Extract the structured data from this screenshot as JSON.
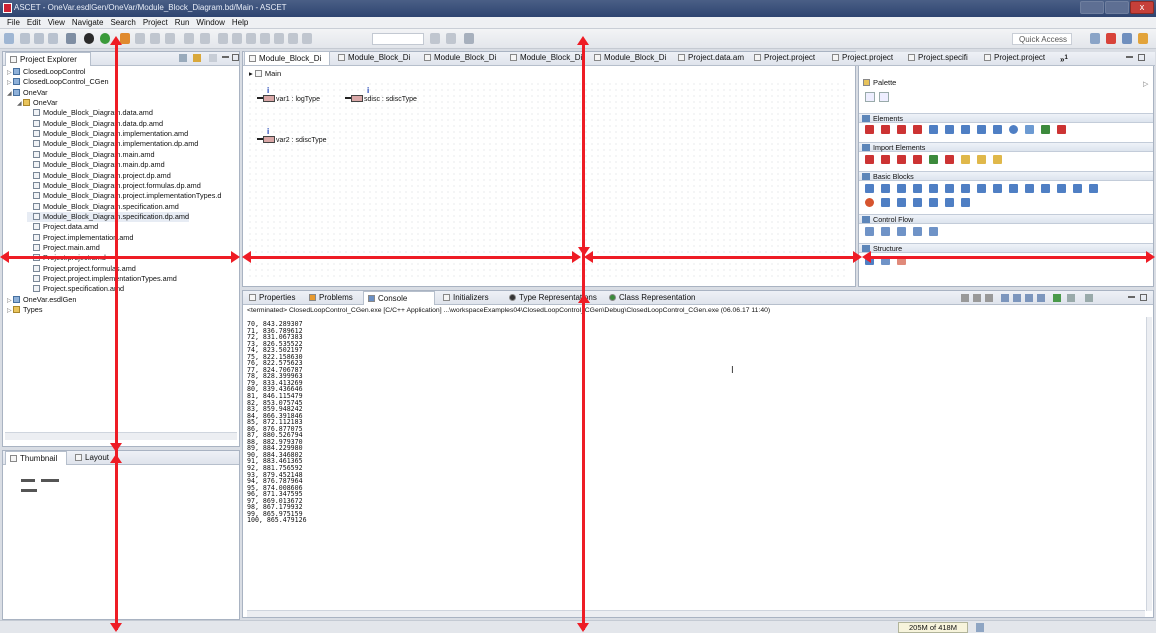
{
  "window": {
    "title": "ASCET - OneVar.esdlGen/OneVar/Module_Block_Diagram.bd/Main - ASCET",
    "close_glyph": "x"
  },
  "menu": [
    "File",
    "Edit",
    "View",
    "Navigate",
    "Search",
    "Project",
    "Run",
    "Window",
    "Help"
  ],
  "toolbar": {
    "quick_access": "Quick Access"
  },
  "project_explorer": {
    "tab_label": "Project Explorer",
    "items": [
      {
        "label": "ClosedLoopControl",
        "depth": 0,
        "icon": "project-icon",
        "expand": "▷"
      },
      {
        "label": "ClosedLoopControl_CGen",
        "depth": 0,
        "icon": "project-icon",
        "expand": "▷"
      },
      {
        "label": "OneVar",
        "depth": 0,
        "icon": "project-icon",
        "expand": "◢"
      },
      {
        "label": "OneVar",
        "depth": 1,
        "icon": "folder-icon",
        "expand": "◢"
      },
      {
        "label": "Module_Block_Diagram.data.amd",
        "depth": 2,
        "icon": "file-icon",
        "expand": ""
      },
      {
        "label": "Module_Block_Diagram.data.dp.amd",
        "depth": 2,
        "icon": "file-icon",
        "expand": ""
      },
      {
        "label": "Module_Block_Diagram.implementation.amd",
        "depth": 2,
        "icon": "file-icon",
        "expand": ""
      },
      {
        "label": "Module_Block_Diagram.implementation.dp.amd",
        "depth": 2,
        "icon": "file-icon",
        "expand": ""
      },
      {
        "label": "Module_Block_Diagram.main.amd",
        "depth": 2,
        "icon": "file-icon",
        "expand": ""
      },
      {
        "label": "Module_Block_Diagram.main.dp.amd",
        "depth": 2,
        "icon": "file-icon",
        "expand": ""
      },
      {
        "label": "Module_Block_Diagram.project.dp.amd",
        "depth": 2,
        "icon": "file-icon",
        "expand": ""
      },
      {
        "label": "Module_Block_Diagram.project.formulas.dp.amd",
        "depth": 2,
        "icon": "file-icon",
        "expand": ""
      },
      {
        "label": "Module_Block_Diagram.project.implementationTypes.d",
        "depth": 2,
        "icon": "file-icon",
        "expand": ""
      },
      {
        "label": "Module_Block_Diagram.specification.amd",
        "depth": 2,
        "icon": "file-icon",
        "expand": ""
      },
      {
        "label": "Module_Block_Diagram.specification.dp.amd",
        "depth": 2,
        "icon": "file-icon",
        "expand": "",
        "selected": true
      },
      {
        "label": "Project.data.amd",
        "depth": 2,
        "icon": "file-icon",
        "expand": ""
      },
      {
        "label": "Project.implementation.amd",
        "depth": 2,
        "icon": "file-icon",
        "expand": ""
      },
      {
        "label": "Project.main.amd",
        "depth": 2,
        "icon": "file-icon",
        "expand": ""
      },
      {
        "label": "Project.project.amd",
        "depth": 2,
        "icon": "file-icon",
        "expand": ""
      },
      {
        "label": "Project.project.formulas.amd",
        "depth": 2,
        "icon": "file-icon",
        "expand": ""
      },
      {
        "label": "Project.project.implementationTypes.amd",
        "depth": 2,
        "icon": "file-icon",
        "expand": ""
      },
      {
        "label": "Project.specification.amd",
        "depth": 2,
        "icon": "file-icon",
        "expand": ""
      },
      {
        "label": "OneVar.esdlGen",
        "depth": 0,
        "icon": "project-icon",
        "expand": "▷"
      },
      {
        "label": "Types",
        "depth": 0,
        "icon": "folder-icon",
        "expand": "▷"
      }
    ]
  },
  "thumbnail": {
    "tabs": [
      "Thumbnail",
      "Layout"
    ]
  },
  "editor": {
    "tabs": [
      "Module_Block_Di",
      "Module_Block_Di",
      "Module_Block_Di",
      "Module_Block_Di",
      "Module_Block_Di",
      "Project.data.am",
      "Project.project",
      "Project.project",
      "Project.specifi",
      "Project.project"
    ],
    "overflow": "»",
    "overflow_count": "1",
    "breadcrumb": "Main",
    "blocks": [
      {
        "label": "var1 : logType",
        "mark": "i"
      },
      {
        "label": "sdisc : sdiscType",
        "mark": "i"
      },
      {
        "label": "var2 : sdiscType",
        "mark": "i"
      }
    ]
  },
  "palette": {
    "title": "Palette",
    "sections": [
      "Elements",
      "Import Elements",
      "Basic Blocks",
      "Control Flow",
      "Structure"
    ]
  },
  "bottom_panel": {
    "tabs": [
      "Properties",
      "Problems",
      "Console",
      "Initializers",
      "Type Representations",
      "Class Representation"
    ],
    "console_header": "<terminated> ClosedLoopControl_CGen.exe [C/C++ Application] ...\\workspaceExamples04\\ClosedLoopControl_CGen\\Debug\\ClosedLoopControl_CGen.exe (06.06.17 11:40)",
    "console_lines": [
      "70, 843.289307",
      "71, 836.789612",
      "72, 831.067383",
      "73, 826.535522",
      "74, 823.502197",
      "75, 822.158630",
      "76, 822.575623",
      "77, 824.706787",
      "78, 828.399963",
      "79, 833.413269",
      "80, 839.436646",
      "81, 846.115479",
      "82, 853.075745",
      "83, 859.948242",
      "84, 866.391846",
      "85, 872.112183",
      "86, 876.877075",
      "87, 880.526794",
      "88, 882.979370",
      "89, 884.229980",
      "90, 884.346802",
      "91, 883.461365",
      "92, 881.756592",
      "93, 879.452148",
      "94, 876.787964",
      "95, 874.008606",
      "96, 871.347595",
      "97, 869.013672",
      "98, 867.179932",
      "99, 865.975159",
      "100, 865.479126"
    ]
  },
  "status": {
    "heap": "205M of 418M"
  },
  "colors": {
    "arrow": "#ee1c25",
    "window_chrome": "#2e4470",
    "panel_border": "#a9b3c2"
  }
}
